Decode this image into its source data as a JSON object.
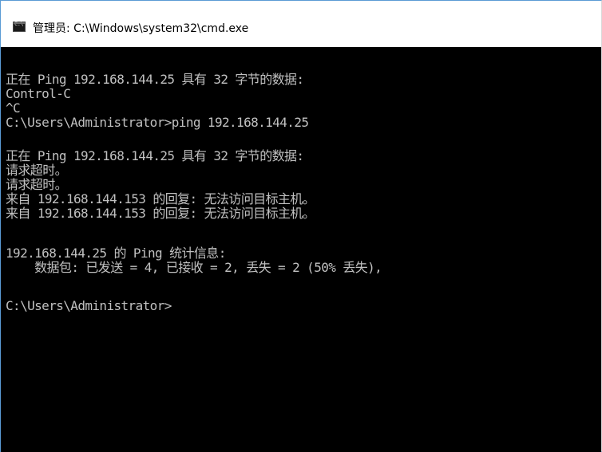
{
  "window": {
    "title": "管理员: C:\\Windows\\system32\\cmd.exe",
    "icon": "cmd-icon"
  },
  "console": {
    "lines": [
      "正在 Ping 192.168.144.25 具有 32 字节的数据:",
      "Control-C",
      "^C",
      "C:\\Users\\Administrator>ping 192.168.144.25",
      "正在 Ping 192.168.144.25 具有 32 字节的数据:",
      "请求超时。",
      "请求超时。",
      "来自 192.168.144.153 的回复: 无法访问目标主机。",
      "来自 192.168.144.153 的回复: 无法访问目标主机。",
      "192.168.144.25 的 Ping 统计信息:",
      "    数据包: 已发送 = 4, 已接收 = 2, 丢失 = 2 (50% 丢失),",
      "C:\\Users\\Administrator>"
    ]
  },
  "colors": {
    "console_background": "#000000",
    "console_text": "#c0c0c0",
    "titlebar_background": "#ffffff",
    "window_border": "#5a9bd5"
  }
}
